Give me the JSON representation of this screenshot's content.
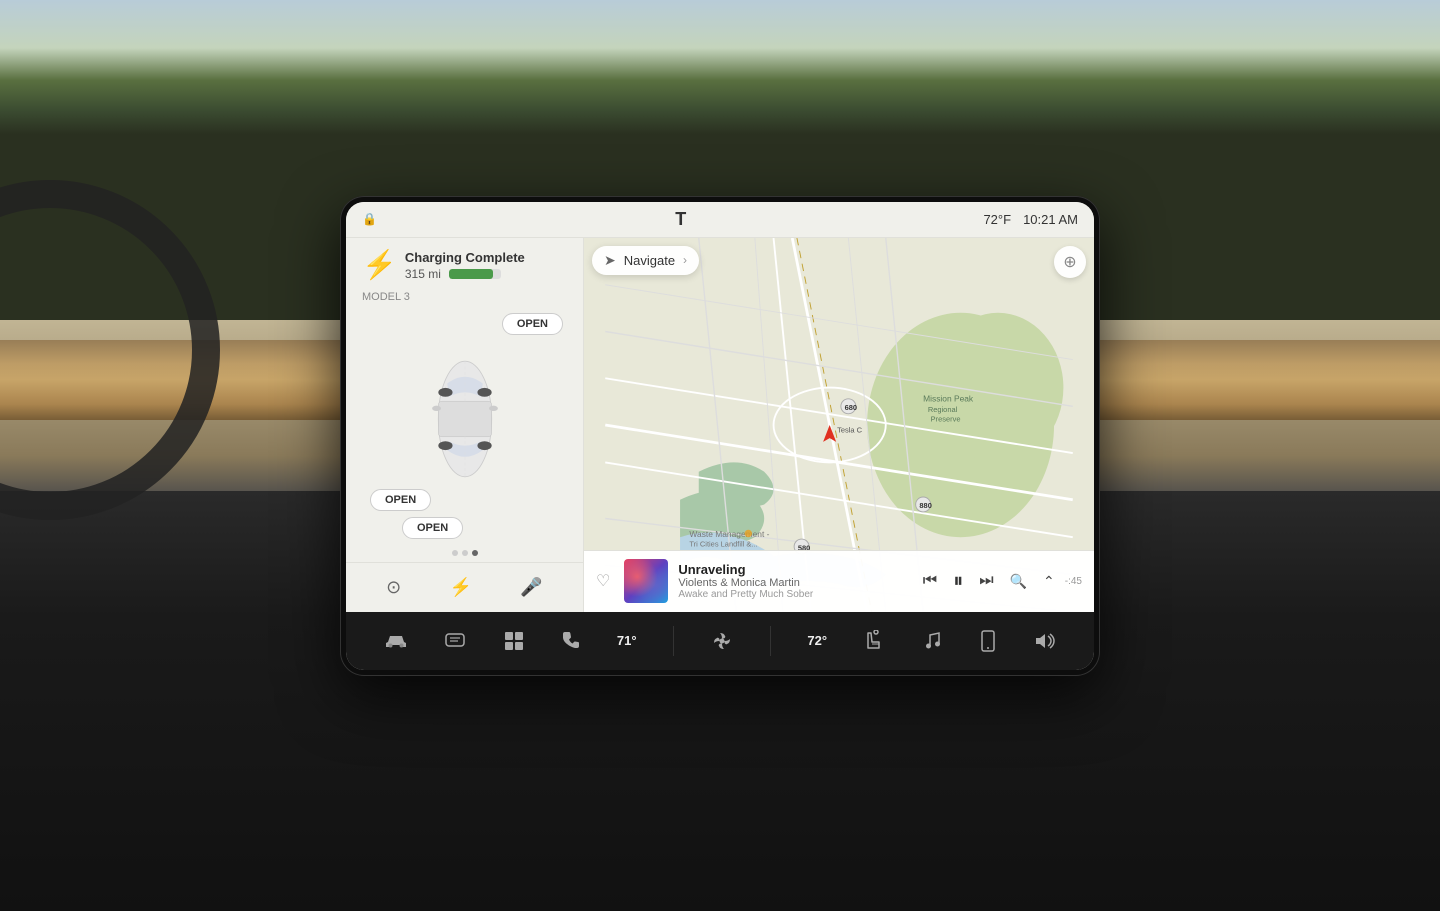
{
  "background": {
    "sky_color": "#d4c8b0",
    "mountain_color": "#5a7040"
  },
  "status_bar": {
    "lock_icon": "🔒",
    "tesla_logo": "T",
    "temperature": "72°F",
    "time": "10:21 AM"
  },
  "left_panel": {
    "lightning_icon": "⚡",
    "charging_title": "Charging Complete",
    "miles": "315 mi",
    "battery_percent": 85,
    "model_label": "MODEL 3",
    "open_top_label": "OPEN",
    "open_left_label": "OPEN",
    "open_trunk_label": "OPEN",
    "bottom_icons": {
      "settings": "⊙",
      "charge": "⚡",
      "mic": "🎤"
    },
    "dots": [
      false,
      false,
      true
    ]
  },
  "map": {
    "navigate_label": "Navigate",
    "compass_icon": "◎",
    "tesla_location": "Tesla C"
  },
  "music": {
    "heart_icon": "♡",
    "title": "Unraveling",
    "artist": "Violents & Monica Martin",
    "album": "Awake and Pretty Much Sober",
    "progress": "-:45",
    "prev_icon": "⏮",
    "pause_icon": "⏸",
    "next_icon": "⏭",
    "search_icon": "🔍",
    "expand_icon": "⌃"
  },
  "taskbar": {
    "items": [
      {
        "name": "car",
        "icon": "🚗",
        "label": ""
      },
      {
        "name": "climate",
        "icon": "❄",
        "label": ""
      },
      {
        "name": "media",
        "icon": "▦",
        "label": ""
      },
      {
        "name": "phone",
        "icon": "📞",
        "label": ""
      },
      {
        "name": "temp-left",
        "value": "71°",
        "label": "71°"
      },
      {
        "name": "fan",
        "icon": "✤",
        "label": ""
      },
      {
        "name": "temp-right",
        "value": "72°",
        "label": "72°"
      },
      {
        "name": "seat",
        "icon": "⚟",
        "label": ""
      },
      {
        "name": "music",
        "icon": "♪",
        "label": ""
      },
      {
        "name": "phone2",
        "icon": "📱",
        "label": ""
      },
      {
        "name": "volume",
        "icon": "🔊",
        "label": ""
      }
    ]
  }
}
